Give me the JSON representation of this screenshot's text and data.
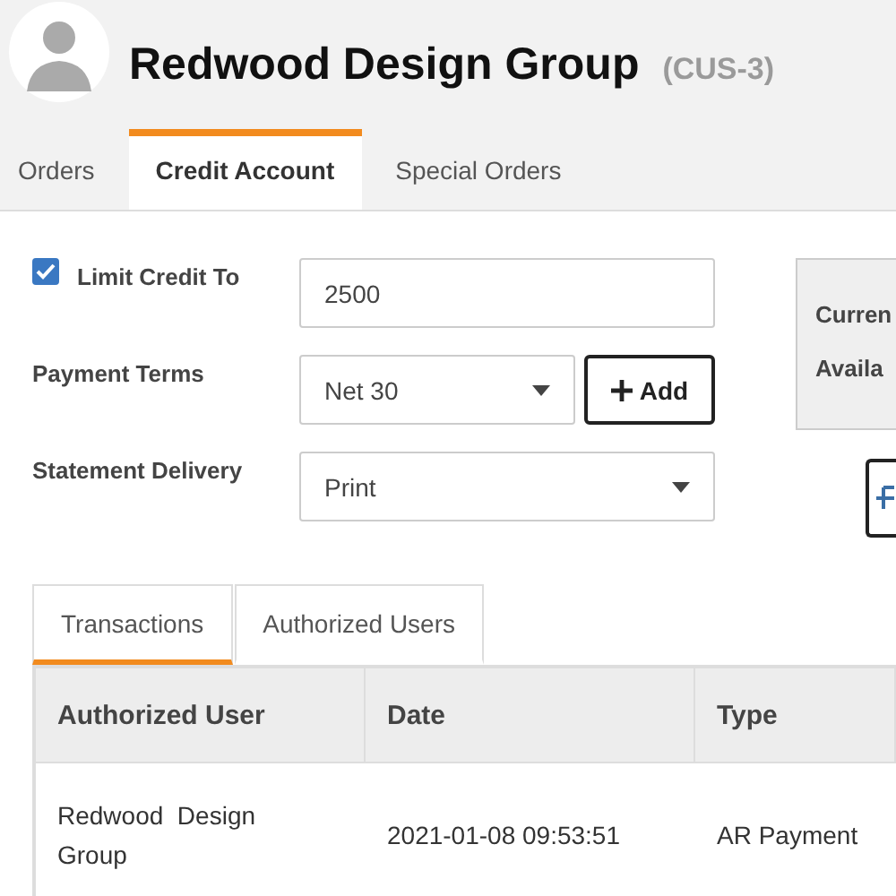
{
  "header": {
    "title": "Redwood Design Group",
    "code": "(CUS-3)"
  },
  "tabs": [
    {
      "label": "Orders",
      "selected": false
    },
    {
      "label": "Credit Account",
      "selected": true
    },
    {
      "label": "Special Orders",
      "selected": false
    }
  ],
  "form": {
    "limit_credit": {
      "label": "Limit Credit To",
      "checked": true,
      "value": "2500"
    },
    "payment_terms": {
      "label": "Payment Terms",
      "value": "Net 30",
      "add_button": "Add"
    },
    "statement_delivery": {
      "label": "Statement Delivery",
      "value": "Print"
    }
  },
  "summary_panel": {
    "lines": [
      "Curren",
      "Availa"
    ]
  },
  "sub_tabs": [
    {
      "label": "Transactions",
      "selected": true
    },
    {
      "label": "Authorized Users",
      "selected": false
    }
  ],
  "table": {
    "columns": [
      "Authorized User",
      "Date",
      "Type"
    ],
    "rows": [
      [
        "Redwood  Design Group",
        "2021-01-08 09:53:51",
        "AR Payment"
      ]
    ]
  }
}
